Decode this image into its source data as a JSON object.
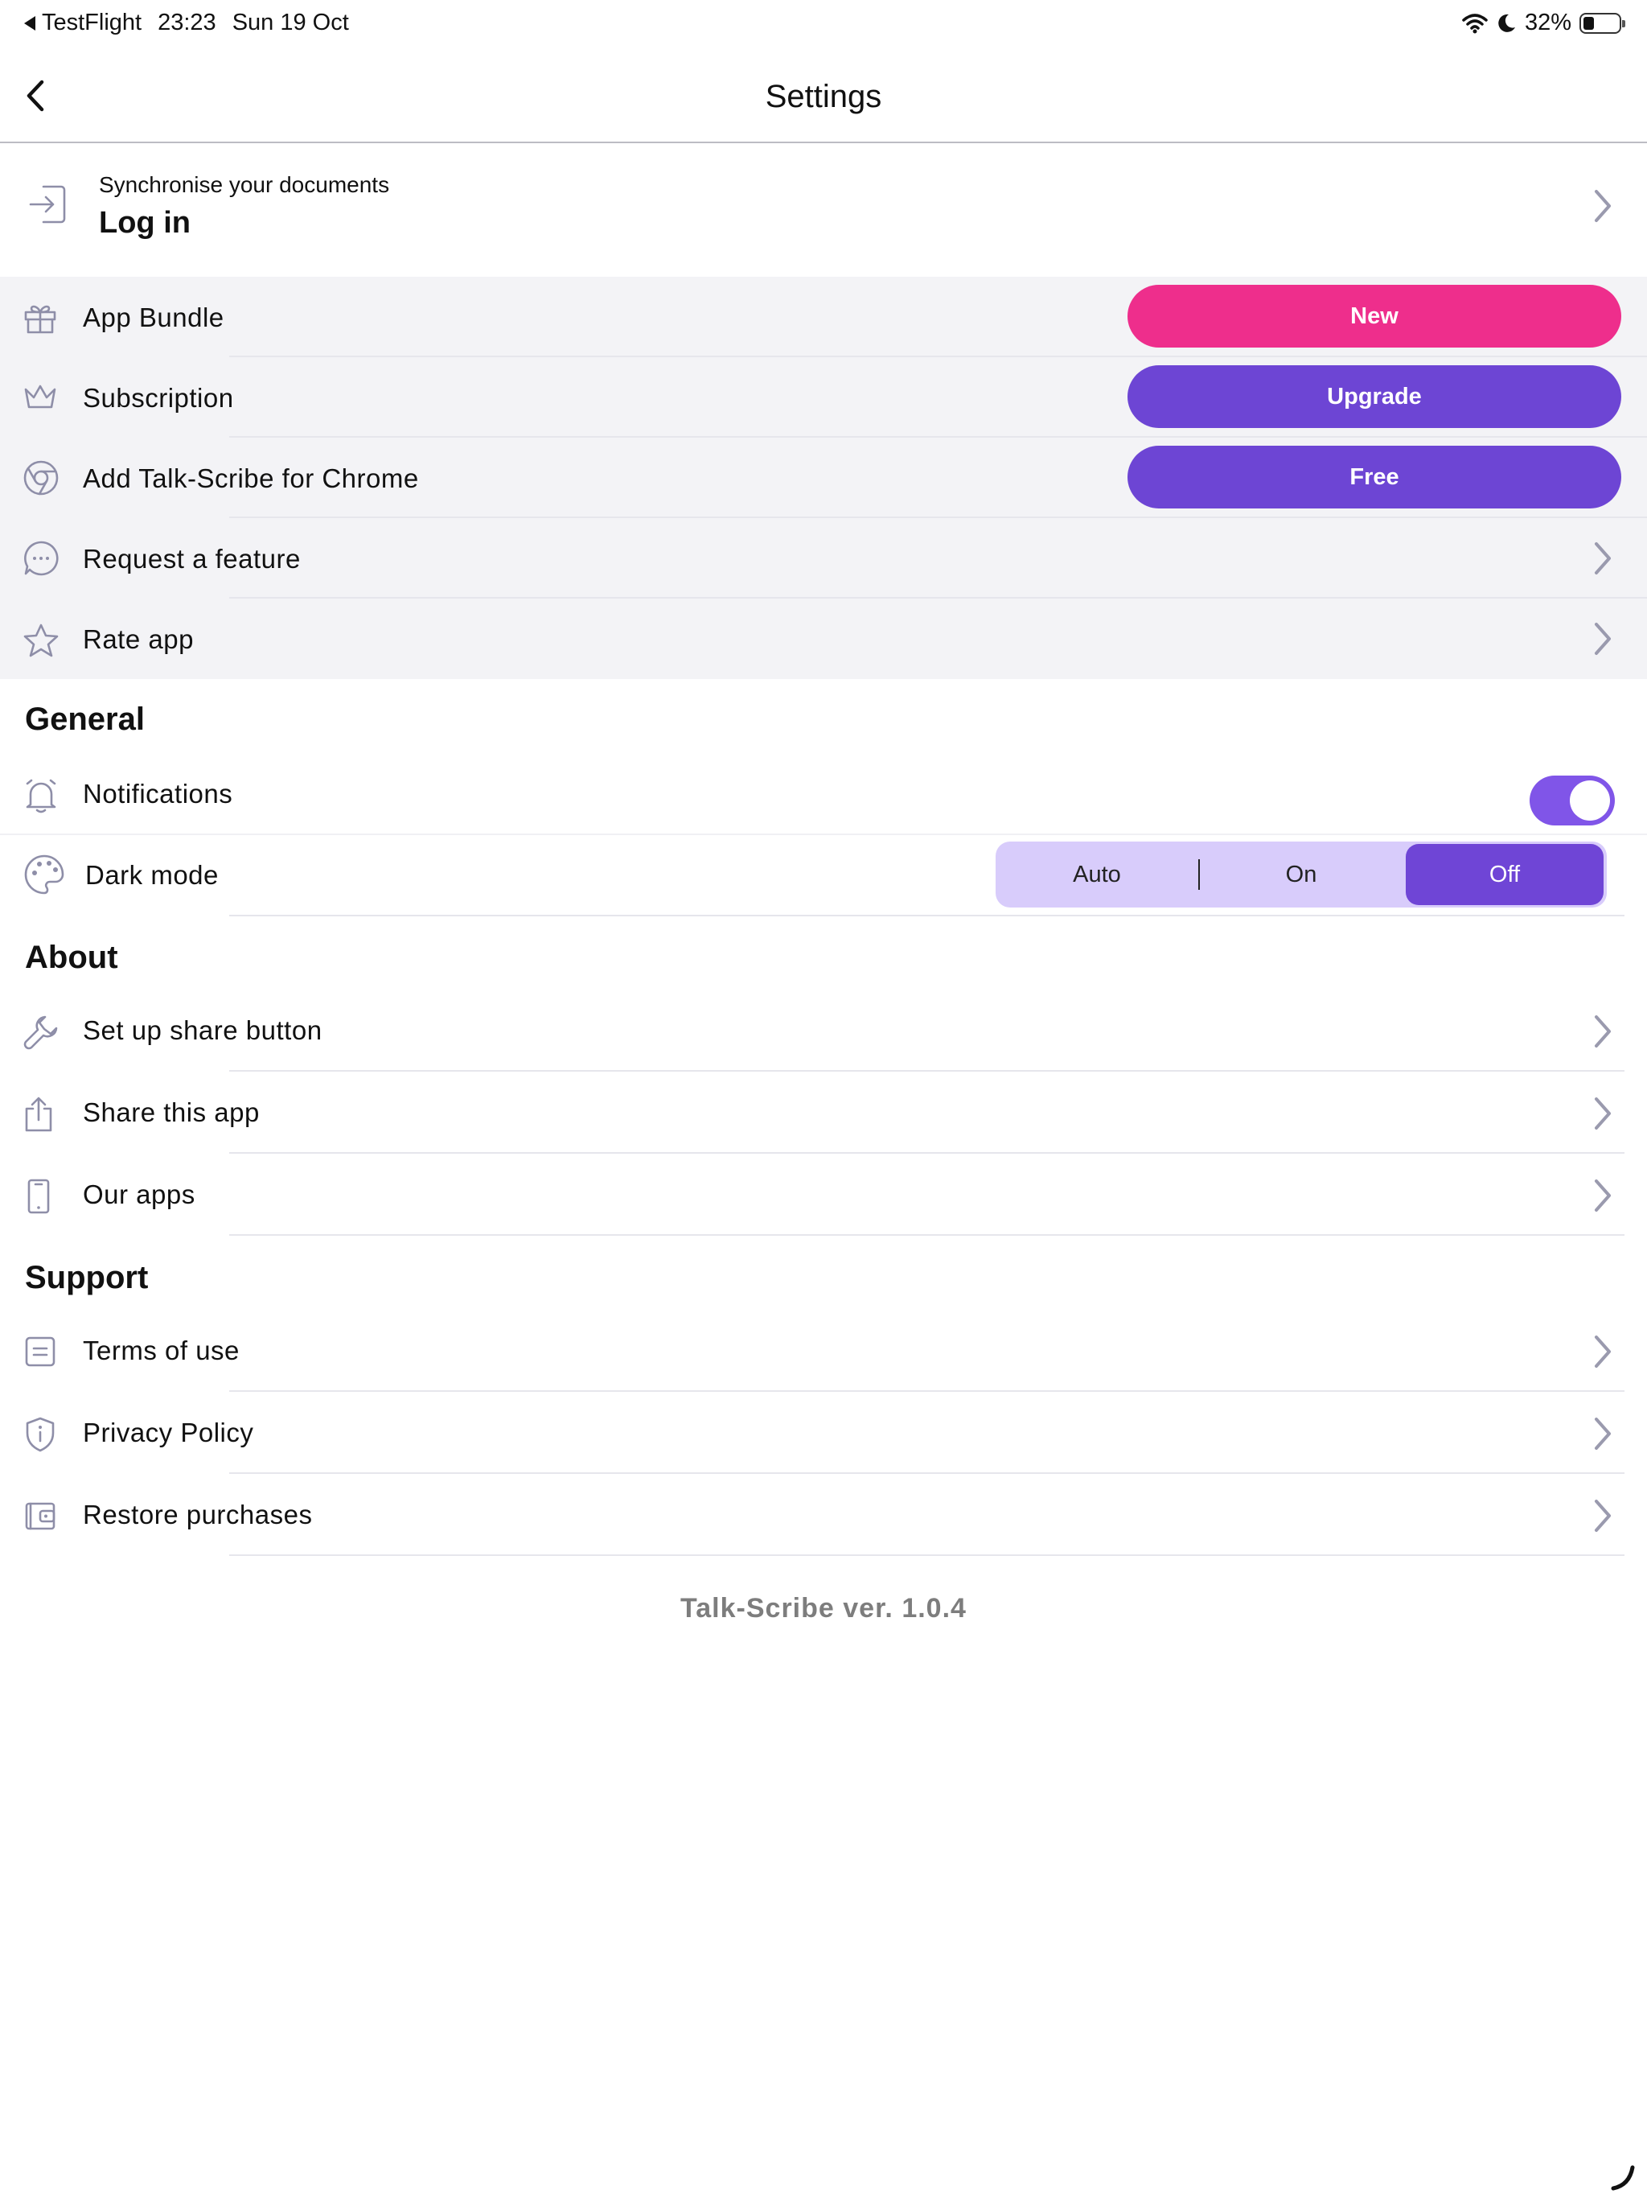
{
  "status_bar": {
    "back_app": "TestFlight",
    "time": "23:23",
    "date": "Sun 19 Oct",
    "battery_percent": "32%",
    "battery_level": 0.32
  },
  "nav": {
    "title": "Settings"
  },
  "login": {
    "subtitle": "Synchronise your documents",
    "title": "Log in"
  },
  "promo": {
    "app_bundle": {
      "label": "App Bundle",
      "button": "New",
      "color": "#ee2e8c"
    },
    "subscription": {
      "label": "Subscription",
      "button": "Upgrade",
      "color": "#6d45d4"
    },
    "chrome": {
      "label": "Add Talk-Scribe for Chrome",
      "button": "Free",
      "color": "#6d45d4"
    },
    "request_feature": {
      "label": "Request a feature"
    },
    "rate_app": {
      "label": "Rate app"
    }
  },
  "general": {
    "heading": "General",
    "notifications": {
      "label": "Notifications",
      "enabled": true
    },
    "dark_mode": {
      "label": "Dark mode",
      "options": [
        "Auto",
        "On",
        "Off"
      ],
      "selected": "Off"
    }
  },
  "about": {
    "heading": "About",
    "items": [
      "Set up share button",
      "Share this app",
      "Our apps"
    ]
  },
  "support": {
    "heading": "Support",
    "items": [
      "Terms of use",
      "Privacy Policy",
      "Restore purchases"
    ]
  },
  "footer": {
    "version": "Talk-Scribe ver. 1.0.4"
  },
  "colors": {
    "accent": "#6d45d4",
    "pink": "#ee2e8c",
    "toggle": "#8055e8",
    "segment_bg": "#d8ccfb"
  }
}
